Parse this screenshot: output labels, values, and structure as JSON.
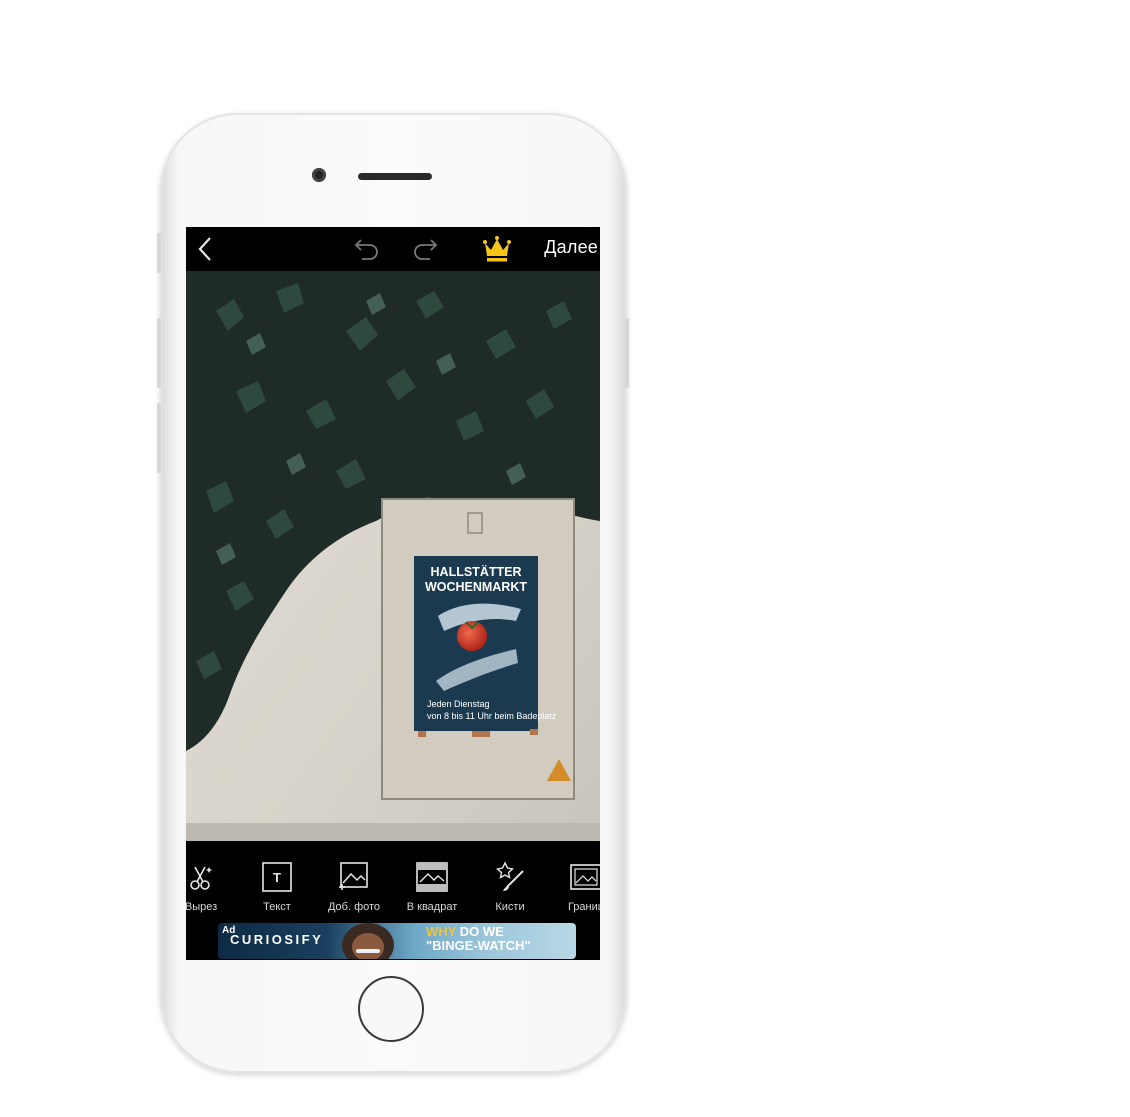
{
  "topbar": {
    "back_icon": "chevron-left-icon",
    "undo_icon": "undo-icon",
    "redo_icon": "redo-icon",
    "premium_icon": "crown-icon",
    "crown_color": "#f5c518",
    "next_label": "Далее"
  },
  "poster": {
    "title_line1": "HALLSTÄTTER",
    "title_line2": "WOCHENMARKT",
    "line1": "Jeden Dienstag",
    "line2": "von 8 bis 11 Uhr beim Badeplatz"
  },
  "toolbar": {
    "tools": [
      {
        "label": "Вырез",
        "icon": "scissors-cutout-icon"
      },
      {
        "label": "Текст",
        "icon": "text-icon"
      },
      {
        "label": "Доб. фото",
        "icon": "add-photo-icon"
      },
      {
        "label": "В квадрат",
        "icon": "fit-square-icon"
      },
      {
        "label": "Кисти",
        "icon": "brush-icon"
      },
      {
        "label": "Границ",
        "icon": "border-icon"
      }
    ]
  },
  "ad": {
    "label": "Ad",
    "brand": "CURIOSIFY",
    "headline_part1": "WHY",
    "headline_part2": "DO WE",
    "headline_line2": "\"BINGE-WATCH\""
  }
}
